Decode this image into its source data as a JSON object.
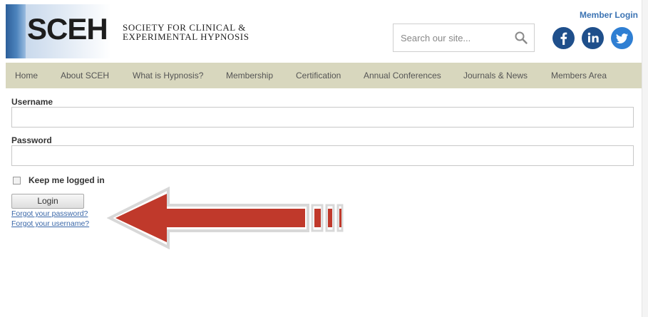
{
  "logo": {
    "abbr": "SCEH",
    "line1": "Society for Clinical &",
    "line2": "Experimental Hypnosis"
  },
  "header": {
    "member_login": "Member Login",
    "search_placeholder": "Search our site..."
  },
  "social": [
    "facebook-icon",
    "linkedin-icon",
    "twitter-icon"
  ],
  "nav": {
    "items": [
      "Home",
      "About SCEH",
      "What is Hypnosis?",
      "Membership",
      "Certification",
      "Annual Conferences",
      "Journals & News",
      "Members Area"
    ]
  },
  "form": {
    "username_label": "Username",
    "username_value": "",
    "password_label": "Password",
    "password_value": "",
    "remember_label": "Keep me logged in",
    "remember_checked": false,
    "login_label": "Login",
    "forgot_password": "Forgot your password?",
    "forgot_username": "Forgot your username?"
  },
  "colors": {
    "nav_bg": "#d8d7be",
    "brand_blue": "#1f4f8b",
    "link": "#3a67a8",
    "arrow": "#c0392b"
  }
}
